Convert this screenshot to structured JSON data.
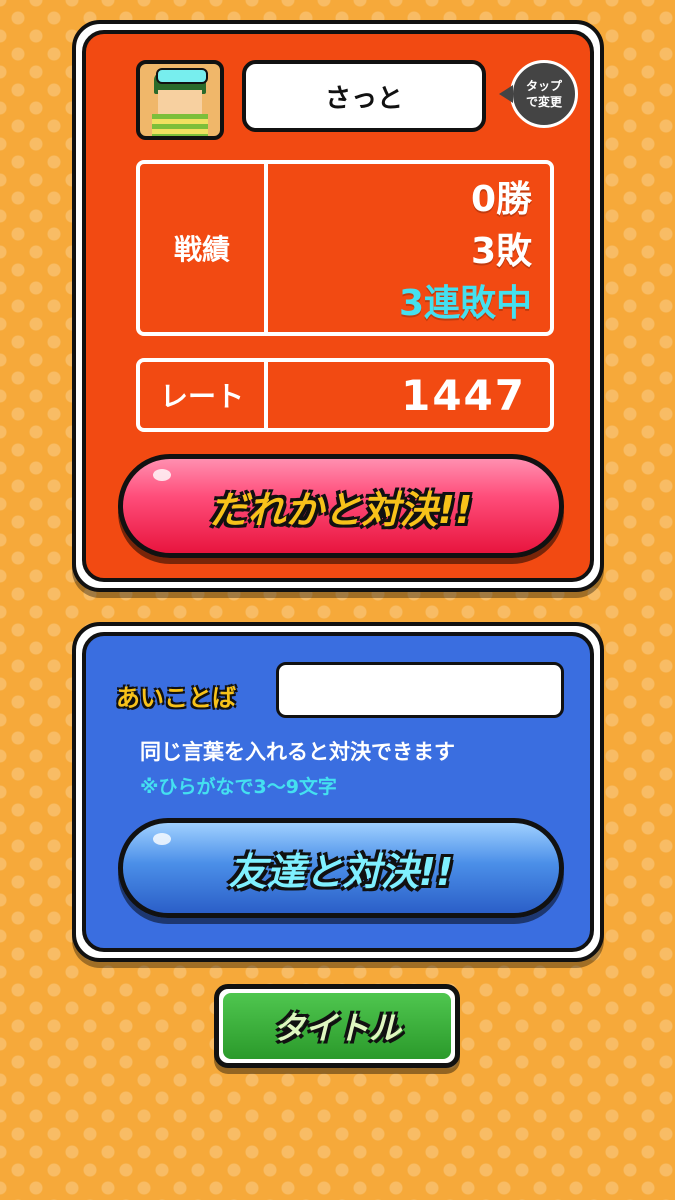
{
  "profile": {
    "player_name": "さっと",
    "tap_badge": {
      "line1": "タップ",
      "line2": "で変更"
    },
    "record": {
      "label": "戦績",
      "wins": "0勝",
      "losses": "3敗",
      "streak": "3連敗中"
    },
    "rate": {
      "label": "レート",
      "value": "1447"
    },
    "random_battle_label": "だれかと対決!!"
  },
  "friend": {
    "passphrase_label": "あいことば",
    "passphrase_value": "",
    "hint": "同じ言葉を入れると対決できます",
    "hint_note": "※ひらがなで3〜9文字",
    "friend_battle_label": "友達と対決!!"
  },
  "footer": {
    "title_button_label": "タイトル"
  },
  "colors": {
    "background": "#f6a93a",
    "profile_panel": "#f24a12",
    "friend_panel": "#3a6ee0",
    "streak": "#44e0f0",
    "button_text_yellow": "#f7c21a"
  },
  "icons": {
    "avatar": "player-avatar",
    "tap_badge": "speech-bubble-icon"
  }
}
